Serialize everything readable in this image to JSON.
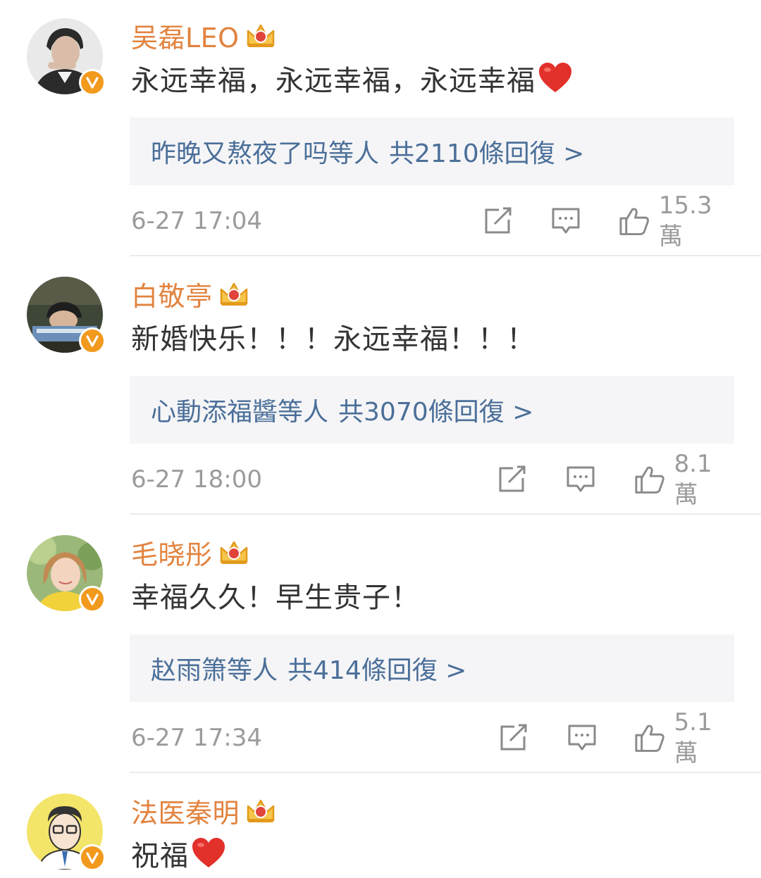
{
  "comments": [
    {
      "name": "吴磊LEO",
      "text": "永远幸福，永远幸福，永远幸福",
      "has_heart": true,
      "reply_users": "昨晚又熬夜了吗等人",
      "reply_count": "共2110條回復 >",
      "time": "6-27 17:04",
      "likes": "15.3萬"
    },
    {
      "name": "白敬亭",
      "text": "新婚快乐！！！永远幸福！！！",
      "has_heart": false,
      "reply_users": "心動添福醬等人",
      "reply_count": "共3070條回復 >",
      "time": "6-27 18:00",
      "likes": "8.1萬"
    },
    {
      "name": "毛晓彤",
      "text": "幸福久久！早生贵子！",
      "has_heart": false,
      "reply_users": "赵雨箫等人",
      "reply_count": "共414條回復 >",
      "time": "6-27 17:34",
      "likes": "5.1萬"
    },
    {
      "name": "法医秦明",
      "text": "祝福",
      "has_heart": true
    }
  ],
  "icons": {
    "crown": "crown-icon",
    "verified": "verified-badge-icon",
    "heart": "heart-emoji-icon",
    "repost": "repost-icon",
    "comment": "comment-icon",
    "like": "like-icon"
  },
  "colors": {
    "name": "#e2833f",
    "reply_link": "#4b6f99",
    "meta": "#9b9b9b",
    "reply_bg": "#f5f5f7",
    "verified_badge": "#f29a1d"
  }
}
